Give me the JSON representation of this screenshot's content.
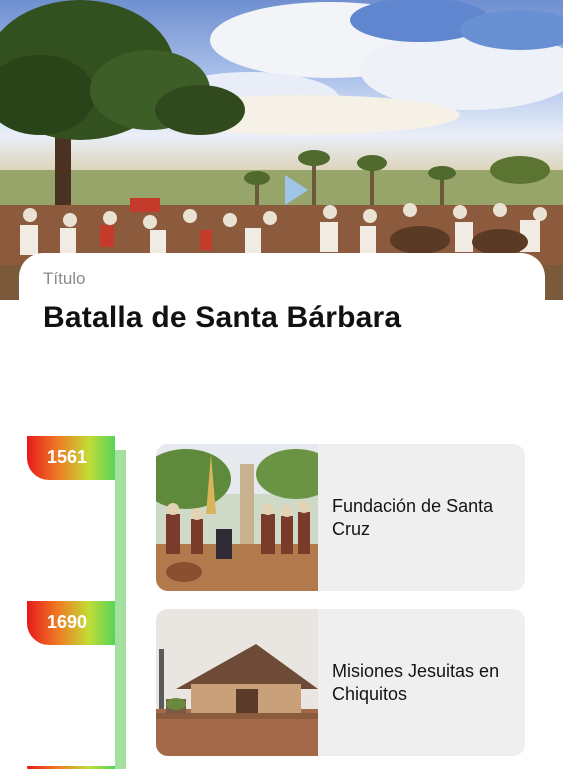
{
  "hero": {
    "image": "battle-painting"
  },
  "header": {
    "label": "Título",
    "title": "Batalla de Santa Bárbara"
  },
  "timeline": {
    "accent_gradient": [
      "#e61a1a",
      "#ef7a24",
      "#c3dc35",
      "#56d45a"
    ],
    "line_color": "#a4e1a0",
    "events": [
      {
        "year": "1561",
        "title": "Fundación de Santa Cruz",
        "image": "founding-painting"
      },
      {
        "year": "1690",
        "title": "Misiones Jesuitas en Chiquitos",
        "image": "jesuit-mission-church"
      }
    ]
  }
}
